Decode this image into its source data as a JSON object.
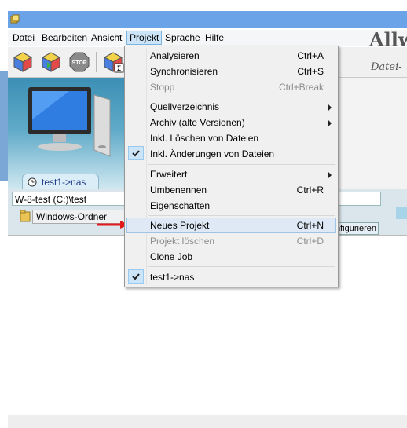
{
  "menubar": {
    "items": [
      {
        "label": "Datei"
      },
      {
        "label": "Bearbeiten"
      },
      {
        "label": "Ansicht"
      },
      {
        "label": "Projekt"
      },
      {
        "label": "Sprache"
      },
      {
        "label": "Hilfe"
      }
    ],
    "open_menu": "Projekt"
  },
  "toolbar": {
    "buttons": [
      "cube-analyze-icon",
      "cube-sync-icon",
      "stop-icon",
      "cube-sum-icon"
    ],
    "stop_label": "STOP"
  },
  "banner": {
    "title": "Allw",
    "subtitle": "Datei-"
  },
  "job_tab": {
    "label": "test1->nas"
  },
  "left_path": {
    "value": "W-8-test (C:)\\test"
  },
  "folder_type": {
    "value": "Windows-Ordner"
  },
  "configure_button": {
    "label": "nfigurieren"
  },
  "project_menu": {
    "items": [
      {
        "label": "Analysieren",
        "shortcut": "Ctrl+A"
      },
      {
        "label": "Synchronisieren",
        "shortcut": "Ctrl+S"
      },
      {
        "label": "Stopp",
        "shortcut": "Ctrl+Break"
      },
      {
        "label": "Quellverzeichnis",
        "shortcut": ""
      },
      {
        "label": "Archiv (alte Versionen)",
        "shortcut": ""
      },
      {
        "label": "Inkl. Löschen von Dateien",
        "shortcut": ""
      },
      {
        "label": "Inkl. Änderungen von Dateien",
        "shortcut": ""
      },
      {
        "label": "Erweitert",
        "shortcut": ""
      },
      {
        "label": "Umbenennen",
        "shortcut": "Ctrl+R"
      },
      {
        "label": "Eigenschaften",
        "shortcut": ""
      },
      {
        "label": "Neues Projekt",
        "shortcut": "Ctrl+N"
      },
      {
        "label": "Projekt löschen",
        "shortcut": "Ctrl+D"
      },
      {
        "label": "Clone Job",
        "shortcut": ""
      },
      {
        "label": "test1->nas",
        "shortcut": ""
      }
    ]
  },
  "colors": {
    "titlebar": "#6aa3e8",
    "menu_highlight": "#dfe9f5",
    "annotation_arrow": "#e0191b"
  }
}
